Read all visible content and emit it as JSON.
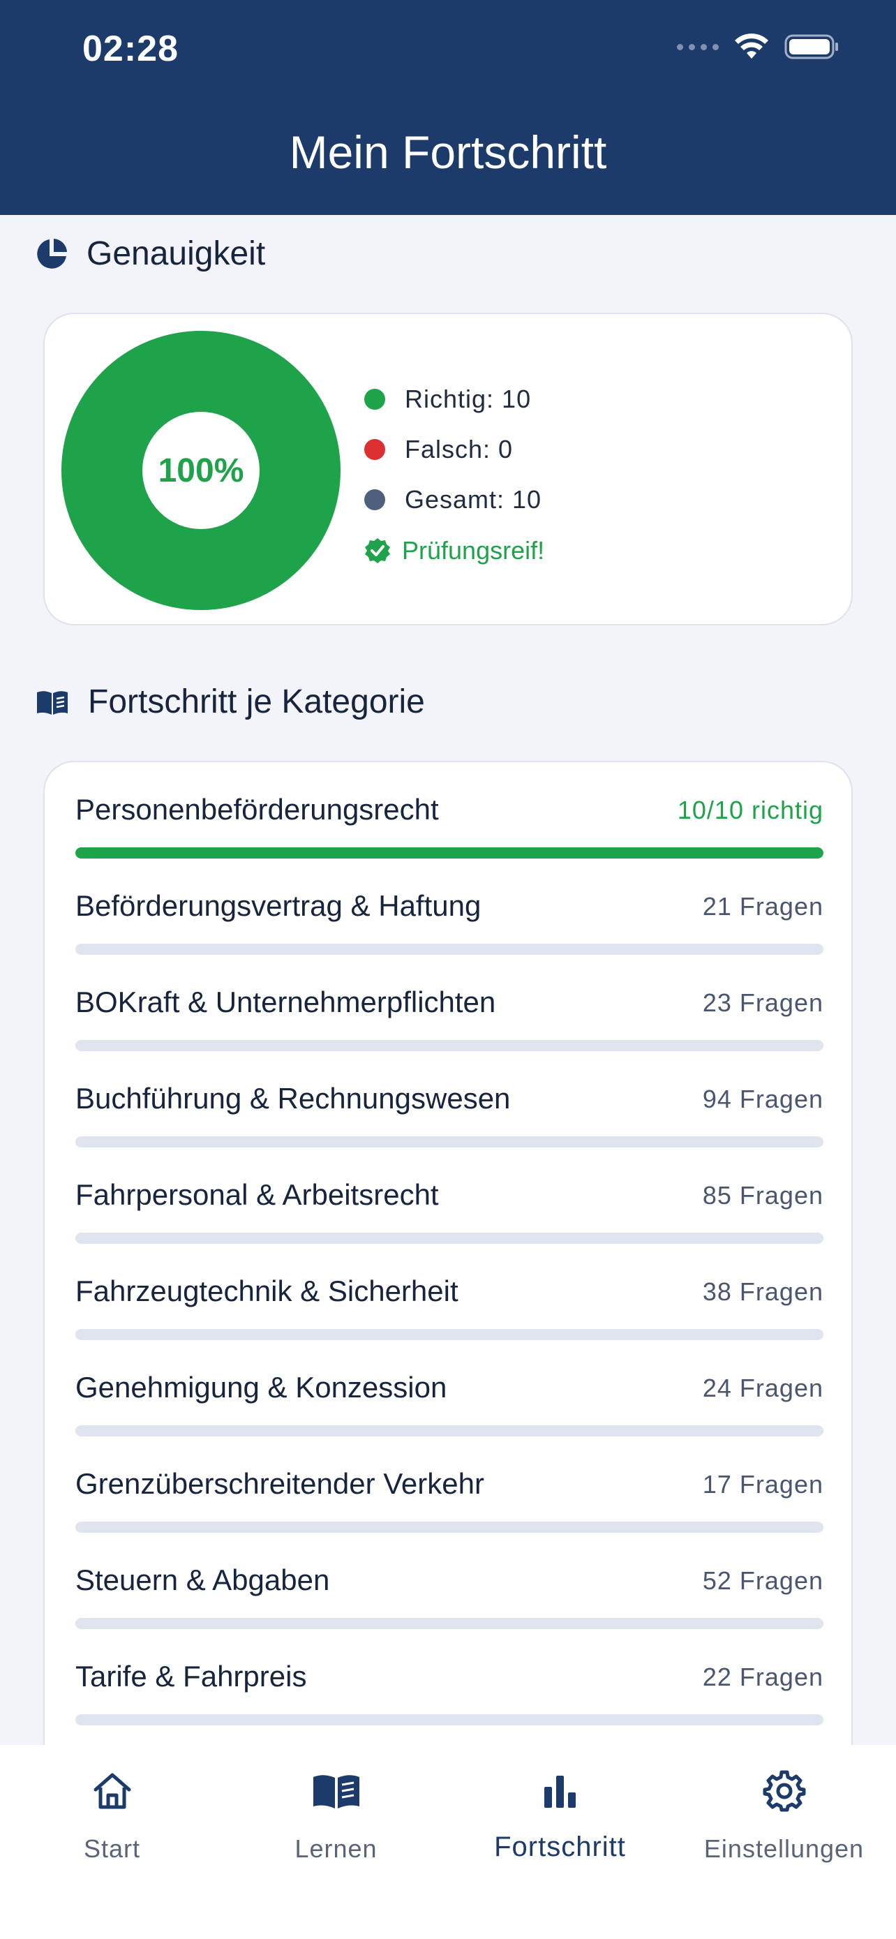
{
  "status": {
    "time": "02:28"
  },
  "header": {
    "title": "Mein Fortschritt"
  },
  "accuracy": {
    "section_title": "Genauigkeit",
    "percent_label": "100%",
    "percent_value": 100,
    "legend": [
      {
        "label": "Richtig: 10",
        "color": "#1fa34a"
      },
      {
        "label": "Falsch: 0",
        "color": "#dc2f2f"
      },
      {
        "label": "Gesamt: 10",
        "color": "#4f5f7e"
      }
    ],
    "status_label": "Prüfungsreif!"
  },
  "categories": {
    "section_title": "Fortschritt je Kategorie",
    "items": [
      {
        "name": "Personenbeförderungsrecht",
        "count": "10/10 richtig",
        "progress": 1.0,
        "done": true
      },
      {
        "name": "Beförderungsvertrag & Haftung",
        "count": "21 Fragen",
        "progress": 0
      },
      {
        "name": "BOKraft & Unternehmerpflichten",
        "count": "23 Fragen",
        "progress": 0
      },
      {
        "name": "Buchführung & Rechnungswesen",
        "count": "94 Fragen",
        "progress": 0
      },
      {
        "name": "Fahrpersonal & Arbeitsrecht",
        "count": "85 Fragen",
        "progress": 0
      },
      {
        "name": "Fahrzeugtechnik & Sicherheit",
        "count": "38 Fragen",
        "progress": 0
      },
      {
        "name": "Genehmigung & Konzession",
        "count": "24 Fragen",
        "progress": 0
      },
      {
        "name": "Grenzüberschreitender Verkehr",
        "count": "17 Fragen",
        "progress": 0
      },
      {
        "name": "Steuern & Abgaben",
        "count": "52 Fragen",
        "progress": 0
      },
      {
        "name": "Tarife & Fahrpreis",
        "count": "22 Fragen",
        "progress": 0
      }
    ]
  },
  "tabs": [
    {
      "label": "Start",
      "icon": "home-icon"
    },
    {
      "label": "Lernen",
      "icon": "book-icon"
    },
    {
      "label": "Fortschritt",
      "icon": "bar-chart-icon",
      "active": true
    },
    {
      "label": "Einstellungen",
      "icon": "gear-icon"
    }
  ],
  "colors": {
    "header": "#1c3a6a",
    "accent": "#1fa34a",
    "track": "#dfe4ee"
  }
}
